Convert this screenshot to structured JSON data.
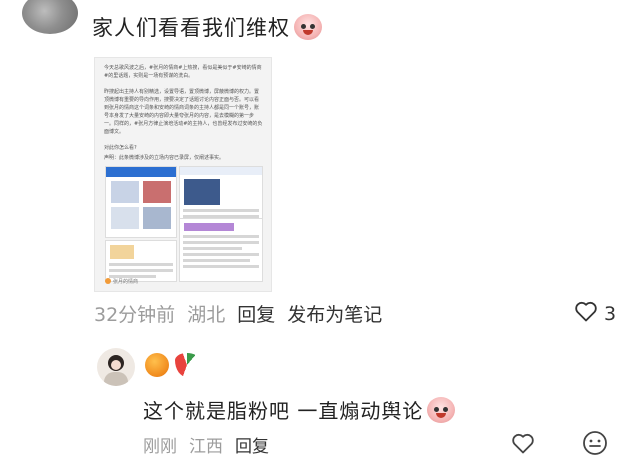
{
  "comment1": {
    "author": "",
    "text": "家人们看看我们维权",
    "meta": {
      "time": "32分钟前",
      "location": "湖北",
      "reply": "回复",
      "publish": "发布为笔记"
    },
    "likes": "3",
    "embedded_image": {
      "para1": "今天总歌风波之后，#张月的情商#上热搜，看似是美似于#安崎的情商#的里话题，实则是一场有预谋的洗白。",
      "para2": "昨搜起出主持人有别精选，设置导语，置顶微博，屏蔽微博的权力。置顶微博有重要的导向作用，搜要决定了话题讨论内容正面与否。可以看到张月的情商这个词条和安崎的情商词条的主持人都是同一个账号，账号本身发了大量安崎的内容即大量夸张月的内容，是去模糊的第一步一。同样的，#张月方律止演培活动#的主持人，也曾经发布过安崎的负面博文。",
      "para3": "对此你怎么看?",
      "para4": "声明：此条微博涉及的立场内容已录屏，仅阐述事实。",
      "footer": "张月的情商"
    }
  },
  "comment2": {
    "text": "这个就是脂粉吧 一直煽动舆论",
    "meta": {
      "time": "刚刚",
      "location": "江西",
      "reply": "回复"
    }
  },
  "icons": [
    "heart-outline-icon",
    "emoji-face-icon",
    "orange-emoji",
    "watermelon-emoji"
  ]
}
